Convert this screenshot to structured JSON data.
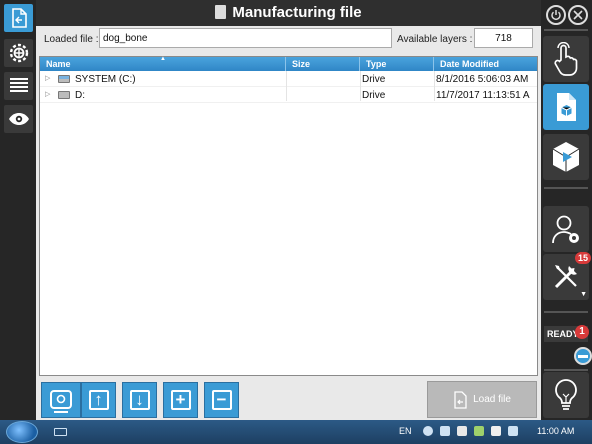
{
  "window": {
    "title": "Manufacturing file"
  },
  "loaded_file": {
    "label": "Loaded file :",
    "value": "dog_bone"
  },
  "available_layers": {
    "label": "Available layers :",
    "value": "718"
  },
  "file_list": {
    "columns": [
      "Name",
      "Size",
      "Type",
      "Date Modified"
    ],
    "rows": [
      {
        "name": "SYSTEM (C:)",
        "size": "",
        "type": "Drive",
        "date": "8/1/2016 5:06:03 AM"
      },
      {
        "name": "D:",
        "size": "",
        "type": "Drive",
        "date": "11/7/2017 11:13:51 A"
      }
    ]
  },
  "buttons": {
    "load_file": "Load file"
  },
  "right_sidebar": {
    "notifications_badge": "15",
    "status_label": "READY",
    "status_badge": "1"
  },
  "taskbar": {
    "language": "EN",
    "time": "11:00 AM"
  },
  "colors": {
    "accent": "#3a9bd5",
    "header": "#2f86c6",
    "badge": "#d83a3a"
  }
}
